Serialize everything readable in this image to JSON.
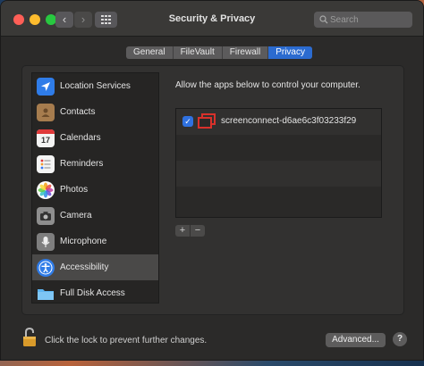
{
  "window": {
    "title": "Security & Privacy",
    "search_placeholder": "Search",
    "back_glyph": "‹",
    "forward_glyph": "›"
  },
  "tabs": [
    {
      "label": "General",
      "active": false
    },
    {
      "label": "FileVault",
      "active": false
    },
    {
      "label": "Firewall",
      "active": false
    },
    {
      "label": "Privacy",
      "active": true
    }
  ],
  "sidebar": {
    "items": [
      {
        "label": "Location Services",
        "icon": "location-arrow-icon",
        "selected": false
      },
      {
        "label": "Contacts",
        "icon": "contacts-book-icon",
        "selected": false
      },
      {
        "label": "Calendars",
        "icon": "calendar-icon",
        "selected": false
      },
      {
        "label": "Reminders",
        "icon": "reminders-list-icon",
        "selected": false
      },
      {
        "label": "Photos",
        "icon": "photos-flower-icon",
        "selected": false
      },
      {
        "label": "Camera",
        "icon": "camera-icon",
        "selected": false
      },
      {
        "label": "Microphone",
        "icon": "microphone-icon",
        "selected": false
      },
      {
        "label": "Accessibility",
        "icon": "accessibility-person-icon",
        "selected": true
      },
      {
        "label": "Full Disk Access",
        "icon": "folder-icon",
        "selected": false
      }
    ],
    "calendar_day": "17"
  },
  "main": {
    "heading": "Allow the apps below to control your computer.",
    "apps": [
      {
        "name": "screenconnect-d6ae6c3f03233f29",
        "checked": true,
        "check_glyph": "✓"
      }
    ],
    "add_glyph": "+",
    "remove_glyph": "−"
  },
  "footer": {
    "lock_text": "Click the lock to prevent further changes.",
    "advanced_label": "Advanced...",
    "help_label": "?"
  },
  "colors": {
    "accent": "#2b6bd0",
    "window_bg": "#2b2a29",
    "app_icon_red": "#d9312b"
  }
}
